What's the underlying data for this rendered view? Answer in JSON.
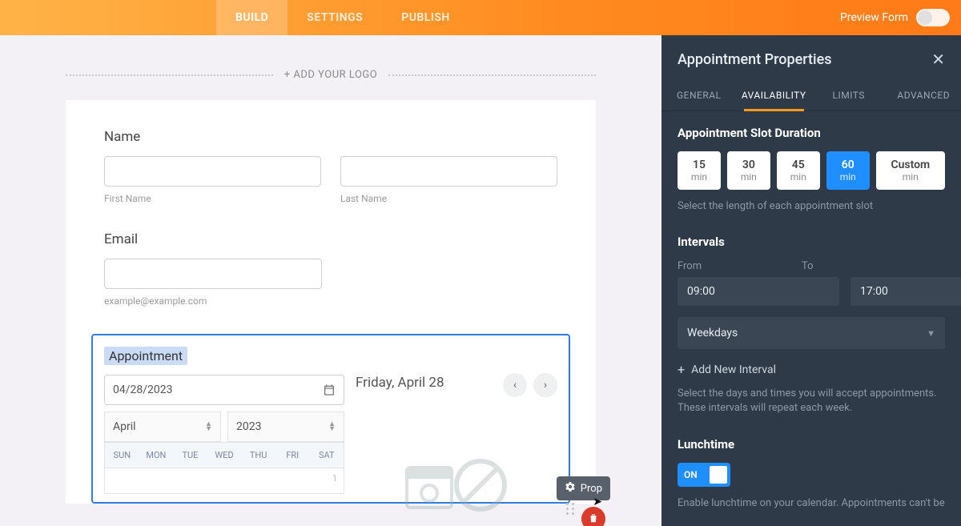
{
  "topbar": {
    "tabs": {
      "build": "BUILD",
      "settings": "SETTINGS",
      "publish": "PUBLISH"
    },
    "preview_label": "Preview Form"
  },
  "canvas": {
    "add_logo": "+ ADD YOUR LOGO",
    "name": {
      "label": "Name",
      "first_sub": "First Name",
      "last_sub": "Last Name"
    },
    "email": {
      "label": "Email",
      "hint": "example@example.com"
    },
    "appointment": {
      "title": "Appointment",
      "date_value": "04/28/2023",
      "month": "April",
      "year": "2023",
      "weekdays": [
        "SUN",
        "MON",
        "TUE",
        "WED",
        "THU",
        "FRI",
        "SAT"
      ],
      "first_row_last_cell": "1",
      "selected_day_label": "Friday, April 28"
    },
    "float": {
      "prop_label": "Prop"
    }
  },
  "panel": {
    "title": "Appointment Properties",
    "tabs": {
      "general": "GENERAL",
      "availability": "AVAILABILITY",
      "limits": "LIMITS",
      "advanced": "ADVANCED"
    },
    "duration": {
      "heading": "Appointment Slot Duration",
      "options": [
        {
          "n": "15",
          "u": "min"
        },
        {
          "n": "30",
          "u": "min"
        },
        {
          "n": "45",
          "u": "min"
        },
        {
          "n": "60",
          "u": "min"
        },
        {
          "n": "Custom",
          "u": "min"
        }
      ],
      "hint": "Select the length of each appointment slot"
    },
    "intervals": {
      "heading": "Intervals",
      "from_label": "From",
      "to_label": "To",
      "from_value": "09:00",
      "to_value": "17:00",
      "days_value": "Weekdays",
      "add_label": "Add New Interval",
      "hint": "Select the days and times you will accept appointments. These intervals will repeat each week."
    },
    "lunch": {
      "heading": "Lunchtime",
      "switch_label": "ON",
      "hint": "Enable lunchtime on your calendar. Appointments can't be"
    }
  }
}
